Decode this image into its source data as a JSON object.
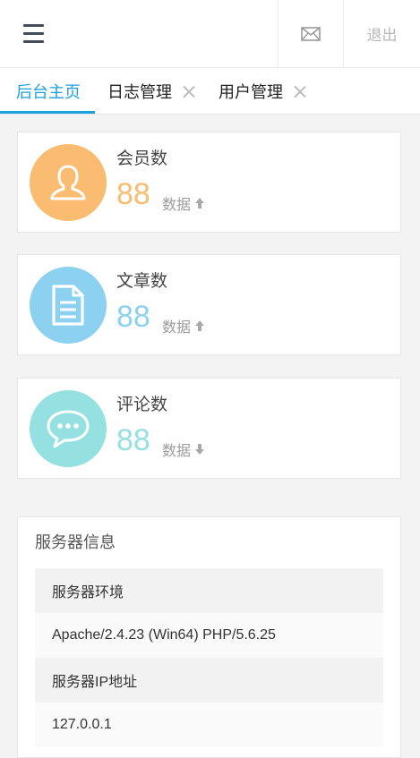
{
  "header": {
    "menu_icon": "hamburger-icon",
    "mail_icon": "mail-icon",
    "logout_label": "退出"
  },
  "tabs": [
    {
      "label": "后台主页",
      "active": true
    },
    {
      "label": "日志管理",
      "closable": true
    },
    {
      "label": "用户管理",
      "closable": true
    }
  ],
  "stats": [
    {
      "title": "会员数",
      "value": "88",
      "sub": "数据",
      "trend": "up",
      "icon": "user-icon",
      "color": "#f9bc71"
    },
    {
      "title": "文章数",
      "value": "88",
      "sub": "数据",
      "trend": "up",
      "icon": "document-icon",
      "color": "#8cd1ef"
    },
    {
      "title": "评论数",
      "value": "88",
      "sub": "数据",
      "trend": "down",
      "icon": "comment-icon",
      "color": "#95e0e0"
    }
  ],
  "server": {
    "title": "服务器信息",
    "rows": [
      {
        "label": "服务器环境",
        "value": "Apache/2.4.23 (Win64) PHP/5.6.25"
      },
      {
        "label": "服务器IP地址",
        "value": "127.0.0.1"
      }
    ]
  },
  "colors": {
    "accent": "#1aa0dd",
    "members": "#f9bc71",
    "articles": "#8cd1ef",
    "comments": "#95e0e0"
  }
}
